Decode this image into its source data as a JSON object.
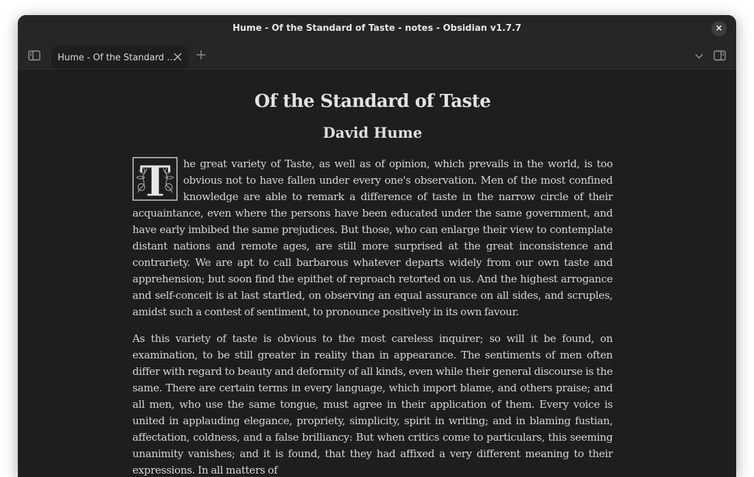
{
  "window": {
    "title": "Hume - Of the Standard of Taste - notes - Obsidian v1.7.7",
    "close_icon": "×"
  },
  "tabs": [
    {
      "label": "Hume - Of the Standard ...",
      "active": true
    }
  ],
  "icons": {
    "left_sidebar": "sidebar-left-icon",
    "tab_close": "close-icon",
    "new_tab": "plus-icon",
    "tab_list": "chevron-down-icon",
    "right_sidebar": "sidebar-right-icon"
  },
  "document": {
    "title": "Of the Standard of Taste",
    "author": "David Hume",
    "dropcap_letter": "T",
    "paragraphs": [
      "he great variety of Taste, as well as of opinion, which prevails in the world, is too obvious not to have fallen under every one's observation. Men of the most confined knowledge are able to remark a difference of taste in the narrow circle of their acquaintance, even where the persons have been educated under the same government, and have early imbibed the same prejudices. But those, who can enlarge their view to contemplate distant nations and remote ages, are still more surprised at the great inconsistence and contrariety. We are apt to call barbarous whatever departs widely from our own taste and apprehension; but soon find the epithet of reproach retorted on us. And the highest arrogance and self-conceit is at last startled, on observing an equal assurance on all sides, and scruples, amidst such a contest of sentiment, to pronounce positively in its own favour.",
      "As this variety of taste is obvious to the most careless inquirer; so will it be found, on examination, to be still greater in reality than in appearance. The sentiments of men often differ with regard to beauty and deformity of all kinds, even while their general discourse is the same. There are certain terms in every language, which import blame, and others praise; and all men, who use the same tongue, must agree in their application of them. Every voice is united in applauding elegance, propriety, simplicity, spirit in writing; and in blaming fustian, affectation, coldness, and a false brilliancy: But when critics come to particulars, this seeming unanimity vanishes; and it is found, that they had affixed a very different meaning to their expressions. In all matters of"
    ]
  },
  "colors": {
    "background": "#1e1e1e",
    "titlebar": "#262626",
    "text": "#d6d6d6"
  }
}
